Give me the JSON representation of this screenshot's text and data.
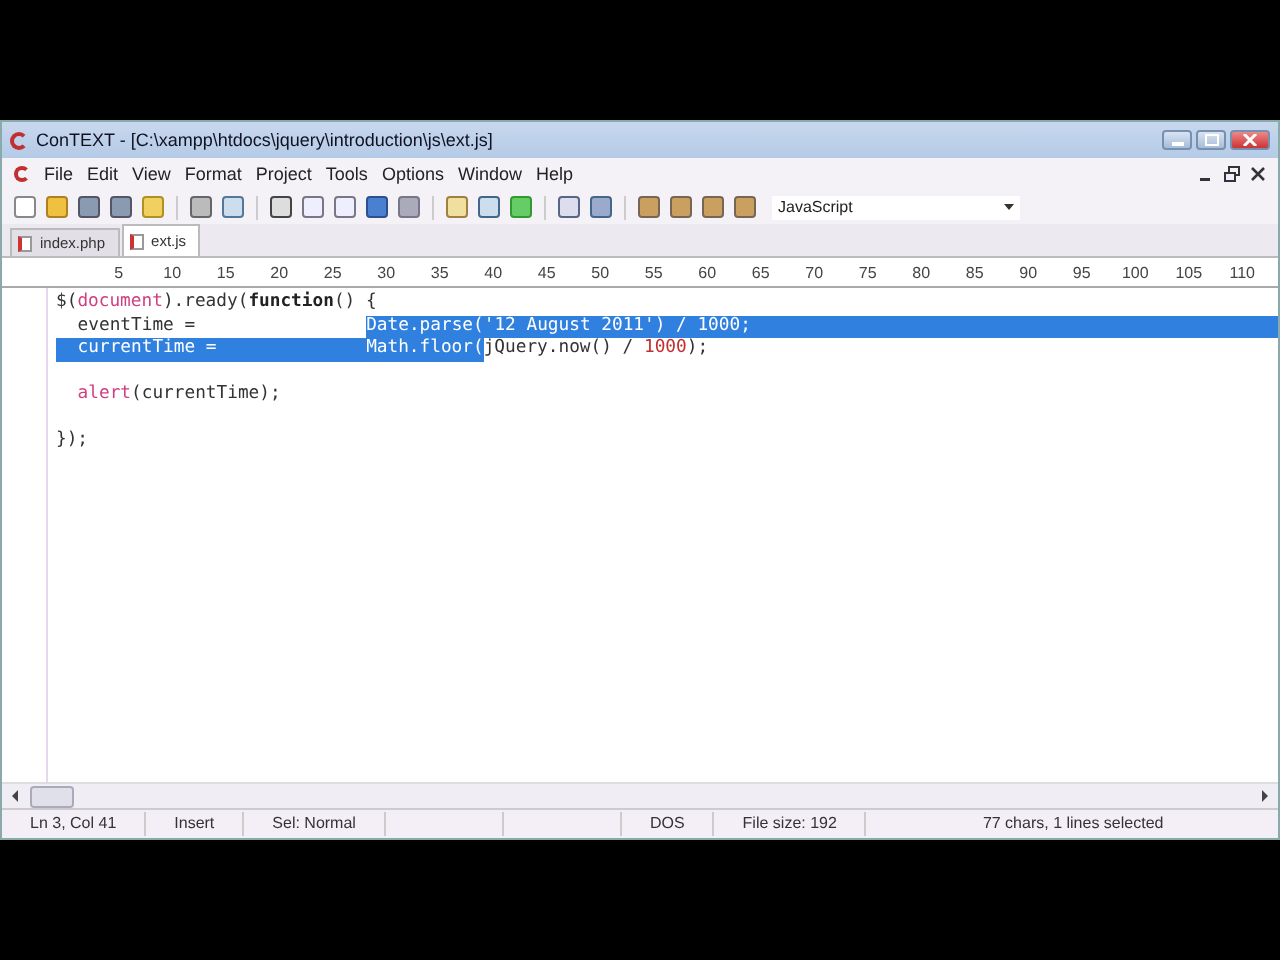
{
  "window": {
    "title": "ConTEXT - [C:\\xampp\\htdocs\\jquery\\introduction\\js\\ext.js]"
  },
  "menu": [
    "File",
    "Edit",
    "View",
    "Format",
    "Project",
    "Tools",
    "Options",
    "Window",
    "Help"
  ],
  "language": {
    "value": "JavaScript"
  },
  "tabs": [
    {
      "label": "index.php",
      "selected": false
    },
    {
      "label": "ext.js",
      "selected": true
    }
  ],
  "ruler": [
    "5",
    "10",
    "15",
    "20",
    "25",
    "30",
    "35",
    "40",
    "45",
    "50",
    "55",
    "60",
    "65",
    "70",
    "75",
    "80",
    "85",
    "90",
    "95",
    "100",
    "105",
    "110"
  ],
  "code": [
    {
      "indented": false,
      "after_blank": false,
      "segments": [
        {
          "text": "$(",
          "kind": "plain",
          "selected": false
        },
        {
          "text": "document",
          "kind": "ident",
          "selected": false
        },
        {
          "text": ").ready(",
          "kind": "plain",
          "selected": false
        },
        {
          "text": "function",
          "kind": "keyword",
          "selected": false
        },
        {
          "text": "() {",
          "kind": "plain",
          "selected": false
        }
      ]
    },
    {
      "indented": true,
      "after_blank": false,
      "segments": [
        {
          "text": "eventTime =                ",
          "kind": "plain",
          "selected": false
        },
        {
          "text": "Date.parse('12 August 2011') / 1000;",
          "kind": "plain",
          "selected": true
        }
      ]
    },
    {
      "indented": true,
      "after_blank": false,
      "segments": [
        {
          "text": "currentTime =              Math.floor(",
          "kind": "plain",
          "selected": true
        },
        {
          "text": "jQuery.now() / ",
          "kind": "plain",
          "selected": false
        },
        {
          "text": "1000",
          "kind": "number",
          "selected": false
        },
        {
          "text": ");",
          "kind": "plain",
          "selected": false
        }
      ]
    },
    {
      "indented": true,
      "after_blank": true,
      "segments": [
        {
          "text": "alert",
          "kind": "ident",
          "selected": false
        },
        {
          "text": "(currentTime);",
          "kind": "plain",
          "selected": false
        }
      ]
    },
    {
      "indented": false,
      "after_blank": true,
      "segments": [
        {
          "text": "});",
          "kind": "plain",
          "selected": false
        }
      ]
    }
  ],
  "status_bar": [
    "Ln 3, Col 41",
    "Insert",
    "Sel: Normal",
    "DOS",
    "File size: 192",
    "77 chars, 1 lines selected"
  ]
}
